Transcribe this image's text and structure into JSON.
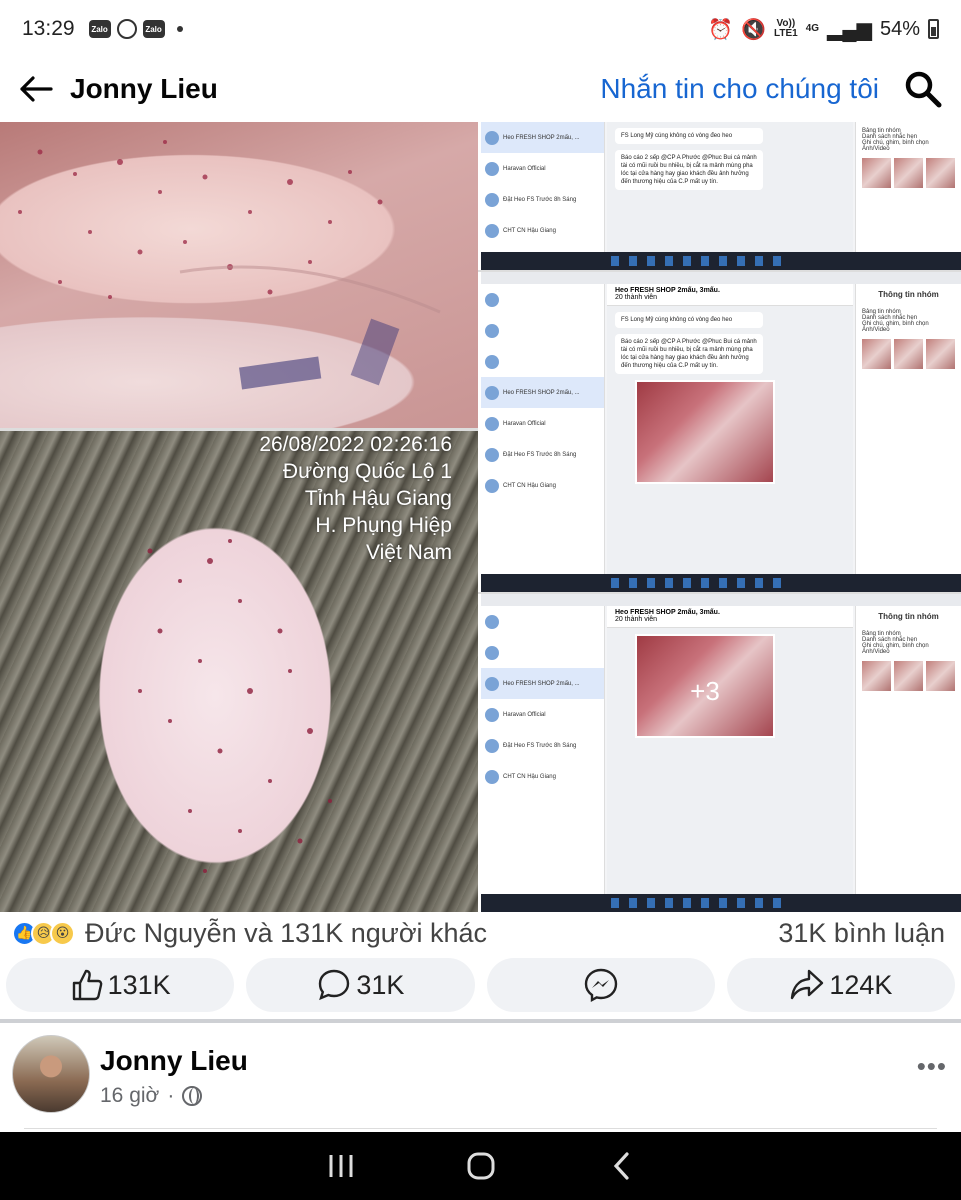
{
  "status_bar": {
    "time": "13:29",
    "notif_zalo_1": "Zalo",
    "notif_zalo_2": "Zalo",
    "volte_top": "Vo))",
    "volte_bottom": "LTE1",
    "network": "4G",
    "battery": "54%"
  },
  "header": {
    "title": "Jonny Lieu",
    "message_link": "Nhắn tin cho chúng tôi",
    "icons": [
      "back-arrow-icon",
      "search-icon"
    ]
  },
  "photos": {
    "watermark_lines": [
      "26/08/2022 02:26:16",
      "Đường Quốc Lộ 1",
      "Tỉnh Hậu Giang",
      "H. Phụng Hiệp",
      "Việt Nam"
    ],
    "more_count": "+3",
    "screenshot": {
      "chat_items": [
        "Heo FRESH SHOP 2mấu, ...",
        "Haravan Official",
        "Đặt Heo FS Trước 8h Sáng",
        "CHT CN Hậu Giang"
      ],
      "group_title": "Heo FRESH SHOP 2mấu, 3mấu.",
      "members": "20 thành viên",
      "message_1": "FS Long Mỹ cúng không có vòng đeo heo",
      "message_2": "Báo cáo 2 sếp @CP A Phước @Phuc Bui cá mảnh tài có mũi ruồi bu nhiều, bị cắt ra mảnh mùng pha lóc tại cửa hàng hay giao khách đều ảnh hưởng đến thương hiệu của C.P mất uy tín.",
      "panel_title": "Thông tin nhóm",
      "panel_section_1": "Bảng tin nhóm",
      "panel_item_1": "Danh sách nhắc hẹn",
      "panel_item_2": "Ghi chú, ghim, bình chọn",
      "panel_section_2": "Ảnh/Video"
    }
  },
  "reactions": {
    "icons": [
      "like-reaction-icon",
      "sad-reaction-icon",
      "wow-reaction-icon"
    ],
    "summary": "Đức Nguyễn và 131K người khác",
    "comments": "31K bình luận"
  },
  "actions": {
    "like": "131K",
    "comment": "31K",
    "send_icon": "messenger-icon",
    "share": "124K"
  },
  "next_post": {
    "author": "Jonny Lieu",
    "time": "16 giờ",
    "separator": "·",
    "more": "•••"
  },
  "colors": {
    "link_blue": "#1766d1",
    "like_blue": "#1877f2",
    "button_bg": "#f0f2f5"
  }
}
